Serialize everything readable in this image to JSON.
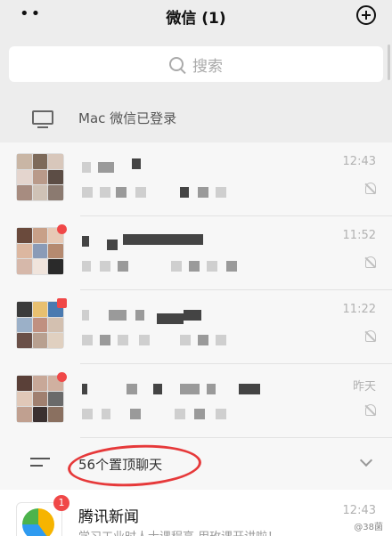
{
  "header": {
    "title": "微信 (1)",
    "more": "••"
  },
  "search": {
    "placeholder": "搜索"
  },
  "login_notice": {
    "text": "Mac 微信已登录"
  },
  "chats": [
    {
      "time": "12:43",
      "unread_dot": false,
      "muted": true
    },
    {
      "time": "11:52",
      "unread_dot": true,
      "muted": true
    },
    {
      "time": "11:22",
      "unread_dot": true,
      "muted": true
    },
    {
      "time": "昨天",
      "unread_dot": true,
      "muted": true
    }
  ],
  "pinned": {
    "label": "56个置顶聊天"
  },
  "news": {
    "name": "腾讯新闻",
    "time": "12:43",
    "badge": "1",
    "preview": "学习工业时人士课程高 用玫课开讲啦！"
  },
  "watermark": "@38菌",
  "colors": {
    "accent_red": "#f04848",
    "background": "#ededed",
    "annotation": "#e6393a"
  }
}
